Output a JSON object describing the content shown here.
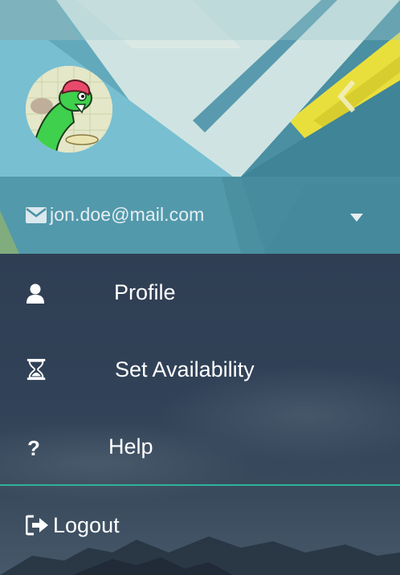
{
  "account": {
    "email": "jon.doe@mail.com",
    "avatar_alt": "user avatar"
  },
  "menu": {
    "items": [
      {
        "label": "Profile",
        "icon": "user-icon"
      },
      {
        "label": "Set Availability",
        "icon": "hourglass-icon"
      },
      {
        "label": "Help",
        "icon": "question-icon"
      }
    ],
    "logout": {
      "label": "Logout",
      "icon": "sign-out-icon"
    }
  },
  "colors": {
    "menu_background": "#2f3e52",
    "divider": "#2fb39a",
    "header_teal": "#5aa2b6",
    "header_yellow": "#e9df3c"
  }
}
